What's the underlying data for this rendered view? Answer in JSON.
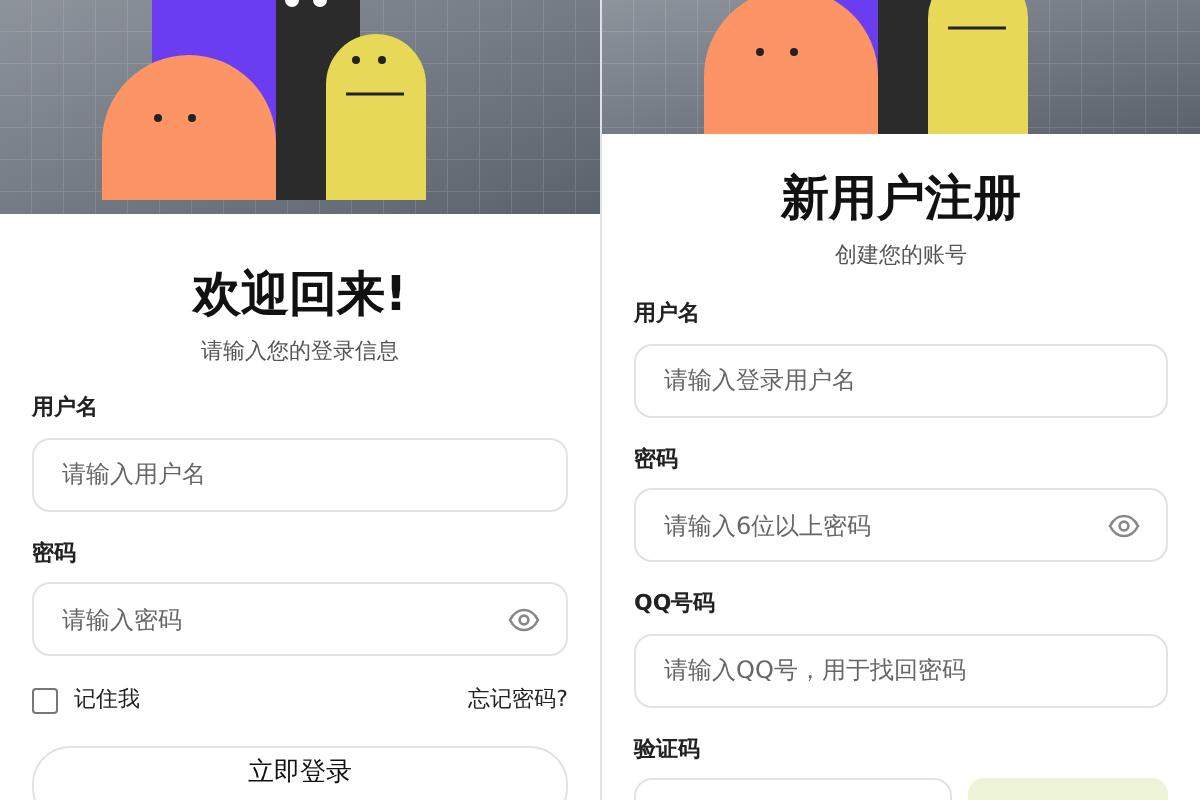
{
  "login": {
    "title": "欢迎回来!",
    "subtitle": "请输入您的登录信息",
    "fields": [
      {
        "kind": "text",
        "label": "用户名",
        "placeholder": "请输入用户名"
      },
      {
        "kind": "password",
        "label": "密码",
        "placeholder": "请输入密码"
      }
    ],
    "remember": {
      "label": "记住我",
      "checked": false
    },
    "forgot": "忘记密码?",
    "submit": "立即登录"
  },
  "register": {
    "title": "新用户注册",
    "subtitle": "创建您的账号",
    "fields": [
      {
        "kind": "text",
        "label": "用户名",
        "placeholder": "请输入登录用户名"
      },
      {
        "kind": "password",
        "label": "密码",
        "placeholder": "请输入6位以上密码"
      },
      {
        "kind": "text",
        "label": "QQ号码",
        "placeholder": "请输入QQ号，用于找回密码"
      },
      {
        "kind": "captcha",
        "label": "验证码"
      }
    ]
  }
}
